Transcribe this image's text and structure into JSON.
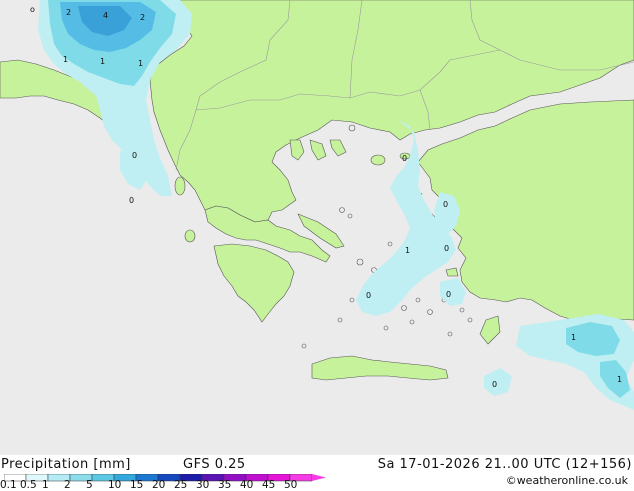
{
  "header": {
    "title": "Precipitation [mm]",
    "model": "GFS 0.25",
    "datetime": "Sa 17-01-2026 21..00 UTC (12+156)",
    "credit": "©weatheronline.co.uk"
  },
  "colors": {
    "sea": "#ebebeb",
    "land": "#c7f29c",
    "border": "#9a9a9a",
    "coast": "#555555",
    "precip_light": "#bfeff2",
    "precip_mid": "#80dbe8",
    "precip_heavy": "#55bde5",
    "precip_max": "#3aa0d8"
  },
  "colorbar": {
    "labels": [
      "0.1",
      "0.5",
      "1",
      "2",
      "5",
      "10",
      "15",
      "20",
      "25",
      "30",
      "35",
      "40",
      "45",
      "50"
    ],
    "colors": [
      "#ffffff",
      "#e0f7fb",
      "#b4ebf4",
      "#8cdceb",
      "#5ec8e4",
      "#33a8dc",
      "#1b77d0",
      "#1547bd",
      "#1b1ca8",
      "#5a14b4",
      "#9110c4",
      "#c010cf",
      "#e514d8",
      "#f53ce6"
    ]
  },
  "map_labels": [
    {
      "id": "lbl-a",
      "text": "o"
    },
    {
      "id": "lbl-b",
      "text": "2"
    },
    {
      "id": "lbl-c",
      "text": "4"
    },
    {
      "id": "lbl-d",
      "text": "2"
    },
    {
      "id": "lbl-e",
      "text": "1"
    },
    {
      "id": "lbl-f",
      "text": "1"
    },
    {
      "id": "lbl-g",
      "text": "1"
    },
    {
      "id": "lbl-h",
      "text": "0"
    },
    {
      "id": "lbl-i",
      "text": "0"
    },
    {
      "id": "lbl-j",
      "text": "0"
    },
    {
      "id": "lbl-k",
      "text": "0"
    },
    {
      "id": "lbl-l",
      "text": "0"
    },
    {
      "id": "lbl-m",
      "text": "1"
    },
    {
      "id": "lbl-n",
      "text": "0"
    },
    {
      "id": "lbl-o",
      "text": "0"
    },
    {
      "id": "lbl-p",
      "text": "1"
    },
    {
      "id": "lbl-q",
      "text": "0"
    },
    {
      "id": "lbl-r",
      "text": "1"
    }
  ]
}
